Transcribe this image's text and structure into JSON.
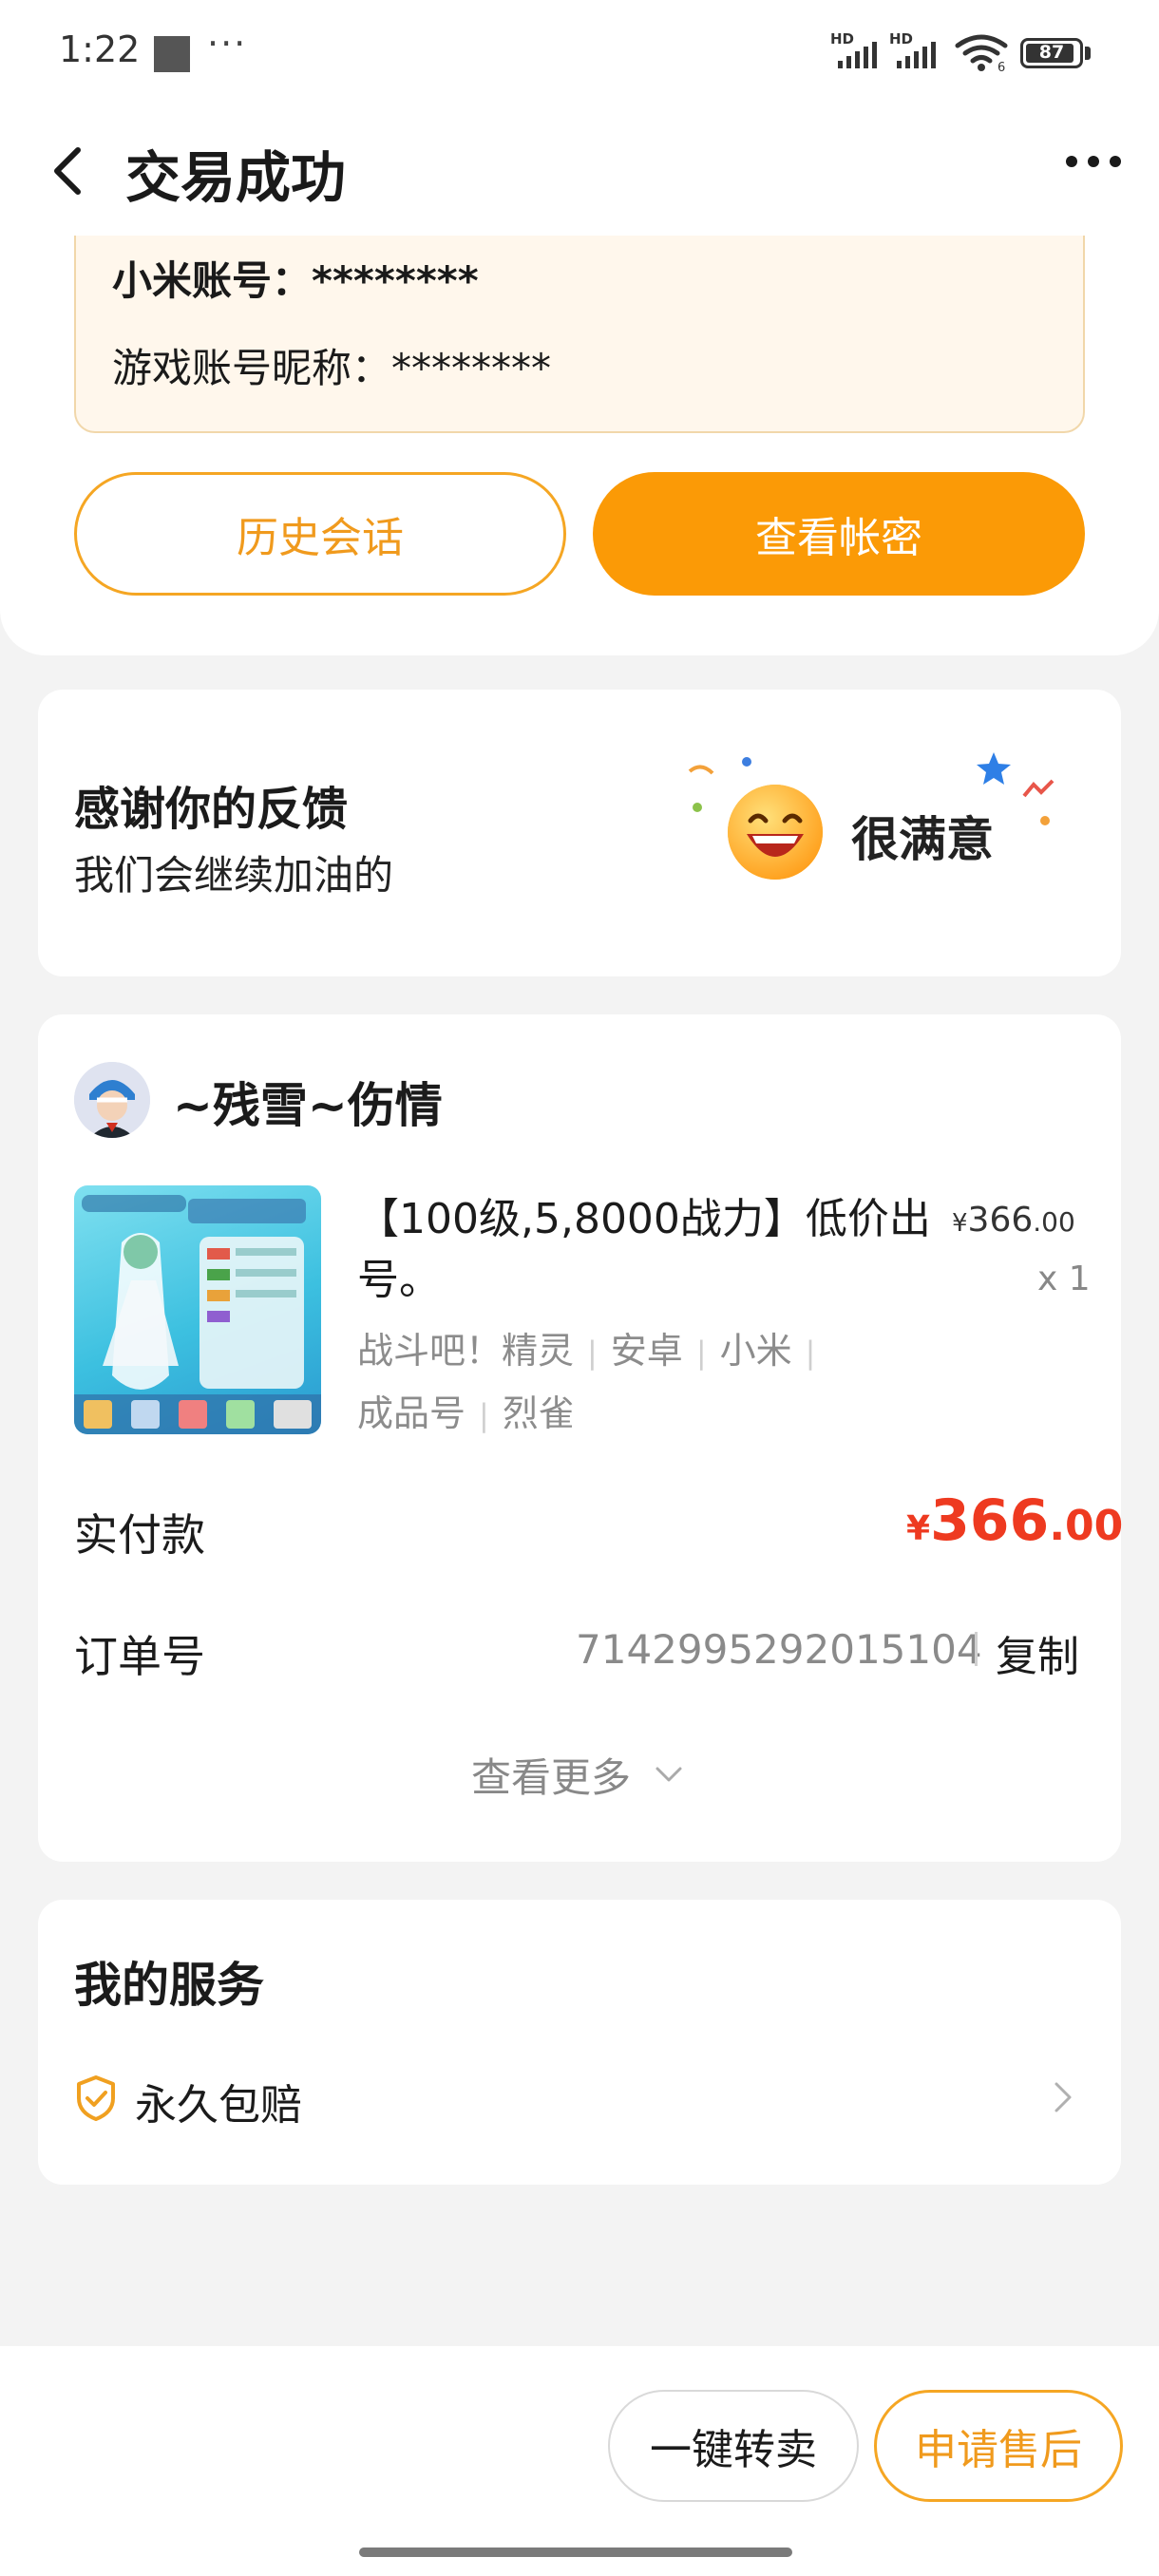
{
  "status_bar": {
    "time": "1:22",
    "dots": "···",
    "hd1": "HD",
    "hd2": "HD",
    "wifi_sub": "6",
    "battery": "87"
  },
  "header": {
    "title": "交易成功",
    "back_icon": "chevron-left-icon",
    "more_icon": "more-dots-icon"
  },
  "account": {
    "mi_account": "小米账号：********",
    "game_nickname": "游戏账号昵称：********"
  },
  "actions": {
    "history": "历史会话",
    "view_credentials": "查看帐密"
  },
  "feedback": {
    "title": "感谢你的反馈",
    "subtitle": "我们会继续加油的",
    "rating": "很满意"
  },
  "order": {
    "seller": "~残雪~伤情",
    "product_title": "【100级,5,8000战力】低价出号。",
    "price_currency": "¥",
    "price_int": "366",
    "price_dec": ".00",
    "quantity": "x 1",
    "tags": [
      "战斗吧！精灵",
      "安卓",
      "小米",
      "成品号",
      "烈雀"
    ],
    "paid_label": "实付款",
    "paid_currency": "¥",
    "paid_int": "366",
    "paid_dec": ".00",
    "order_no_label": "订单号",
    "order_no": "7142995292015104",
    "copy": "复制",
    "see_more": "查看更多"
  },
  "services": {
    "title": "我的服务",
    "item": "永久包赔"
  },
  "bottom": {
    "resell": "一键转卖",
    "after_sale": "申请售后"
  },
  "colors": {
    "accent": "#fb9a06",
    "accent_text": "#f09a1d",
    "price_red": "#ee3a20",
    "card_bg": "#fff7ec"
  }
}
